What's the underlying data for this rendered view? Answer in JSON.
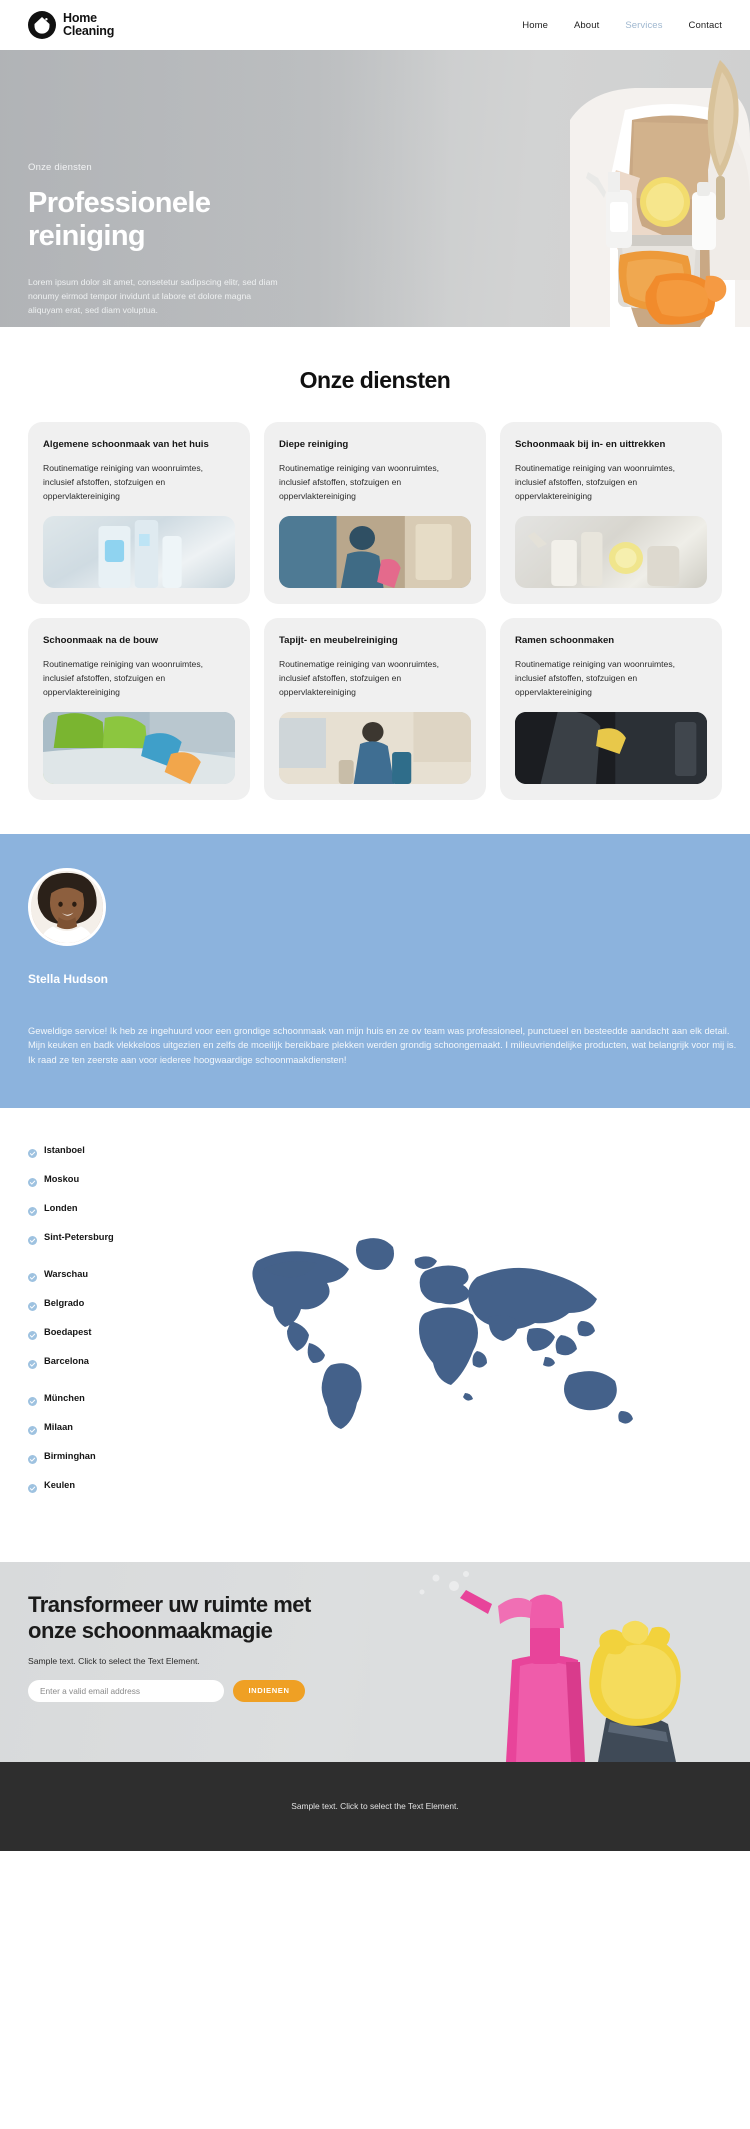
{
  "header": {
    "brand": {
      "line1": "Home",
      "line2": "Cleaning",
      "icon": "house-droplet-logo-icon"
    },
    "nav": [
      {
        "label": "Home",
        "active": false
      },
      {
        "label": "About",
        "active": false
      },
      {
        "label": "Services",
        "active": true
      },
      {
        "label": "Contact",
        "active": false
      }
    ]
  },
  "hero": {
    "eyebrow": "Onze diensten",
    "title": "Professionele reiniging",
    "description": "Lorem ipsum dolor sit amet, consetetur sadipscing elitr, sed diam nonumy eirmod tempor invidunt ut labore et dolore magna aliquyam erat, sed diam voluptua."
  },
  "services": {
    "title": "Onze diensten",
    "cards": [
      {
        "title": "Algemene schoonmaak van het huis",
        "desc": "Routinematige reiniging van woonruimtes, inclusief afstoffen, stofzuigen en oppervlaktereiniging",
        "image": "bathroom-cleaning-supplies-photo"
      },
      {
        "title": "Diepe reiniging",
        "desc": "Routinematige reiniging van woonruimtes, inclusief afstoffen, stofzuigen en oppervlaktereiniging",
        "image": "deep-cleaning-worker-photo"
      },
      {
        "title": "Schoonmaak bij in- en uittrekken",
        "desc": "Routinematige reiniging van woonruimtes, inclusief afstoffen, stofzuigen en oppervlaktereiniging",
        "image": "move-in-out-supplies-photo"
      },
      {
        "title": "Schoonmaak na de bouw",
        "desc": "Routinematige reiniging van woonruimtes, inclusief afstoffen, stofzuigen en oppervlaktereiniging",
        "image": "post-construction-table-photo"
      },
      {
        "title": "Tapijt- en meubelreiniging",
        "desc": "Routinematige reiniging van woonruimtes, inclusief afstoffen, stofzuigen en oppervlaktereiniging",
        "image": "carpet-upholstery-cleaner-photo"
      },
      {
        "title": "Ramen schoonmaken",
        "desc": "Routinematige reiniging van woonruimtes, inclusief afstoffen, stofzuigen en oppervlaktereiniging",
        "image": "window-cleaning-photo"
      }
    ]
  },
  "testimonial": {
    "avatar": "customer-portrait-photo",
    "name": "Stella Hudson",
    "quote": "Geweldige service! Ik heb ze ingehuurd voor een grondige schoonmaak van mijn huis en ze ov team was professioneel, punctueel en besteedde aandacht aan elk detail. Mijn keuken en badk vlekkeloos uitgezien en zelfs de moeilijk bereikbare plekken werden grondig schoongemaakt. I milieuvriendelijke producten, wat belangrijk voor mij is. Ik raad ze ten zeerste aan voor iederee hoogwaardige schoonmaakdiensten!",
    "background_color": "#8cb3dd"
  },
  "locations": {
    "check_icon": "check-circle-icon",
    "groups": [
      {
        "cities": [
          "Istanboel",
          "Moskou",
          "Londen",
          "Sint-Petersburg"
        ]
      },
      {
        "cities": [
          "Warschau",
          "Belgrado",
          "Boedapest",
          "Barcelona"
        ]
      },
      {
        "cities": [
          "München",
          "Milaan",
          "Birminghan",
          "Keulen"
        ]
      }
    ],
    "map": "world-map-graphic",
    "map_color": "#44618a"
  },
  "cta": {
    "title": "Transformeer uw ruimte met onze schoonmaakmagie",
    "subtitle": "Sample text. Click to select the Text Element.",
    "input_placeholder": "Enter a valid email address",
    "input_value": "",
    "button_label": "INDIENEN",
    "button_color": "#efa024",
    "image": "spray-bottle-glove-photo"
  },
  "footer": {
    "text": "Sample text. Click to select the Text Element.",
    "background_color": "#2e2e2e"
  }
}
